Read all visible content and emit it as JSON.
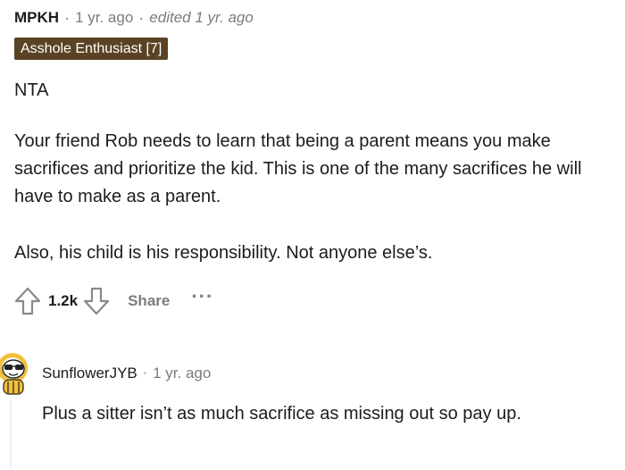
{
  "comment": {
    "author": "MPKH",
    "separator": "·",
    "time": "1 yr. ago",
    "edited": "edited 1 yr. ago",
    "flair": "Asshole Enthusiast [7]",
    "paragraphs": [
      "NTA",
      "Your friend Rob needs to learn that being a parent means you make sacrifices and prioritize the kid. This is one of the many sacrifices he will have to make as a parent.",
      "Also, his child is his responsibility. Not anyone else’s."
    ],
    "actions": {
      "upvote_icon": "upvote-arrow-icon",
      "score": "1.2k",
      "downvote_icon": "downvote-arrow-icon",
      "share_label": "Share",
      "more_label": "···"
    }
  },
  "reply": {
    "avatar_icon": "snoo-avatar-icon",
    "author": "SunflowerJYB",
    "separator": "·",
    "time": "1 yr. ago",
    "text": "Plus a sitter isn’t as much sacrifice as missing out so pay up."
  },
  "colors": {
    "flair_bg": "#5a4324",
    "muted": "#7c7c7c",
    "text": "#1c1c1c",
    "thread_line": "#edeff1"
  }
}
